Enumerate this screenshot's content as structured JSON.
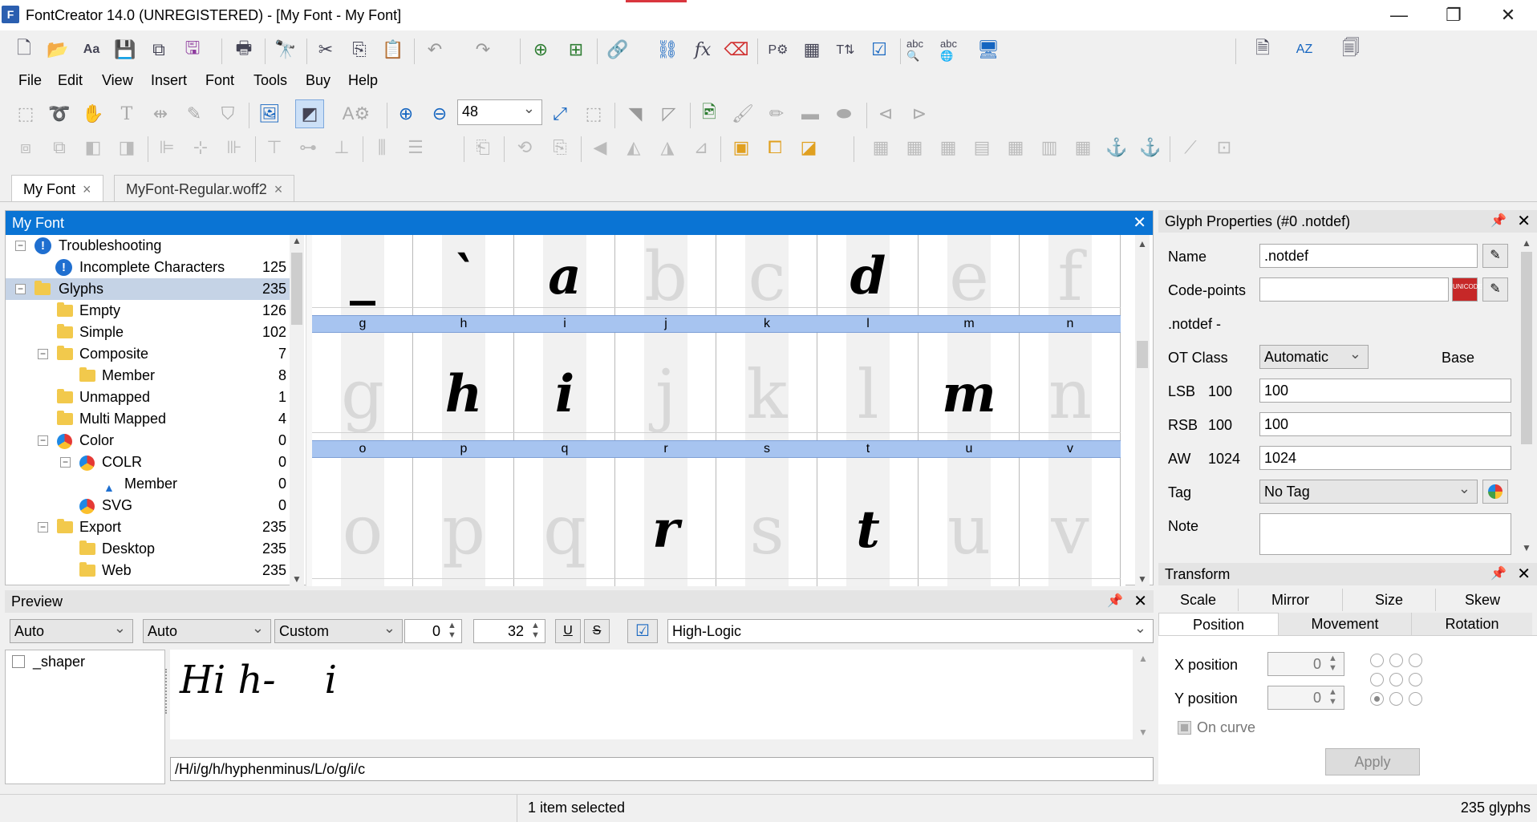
{
  "window": {
    "title": "FontCreator 14.0 (UNREGISTERED) - [My Font - My Font]",
    "app_icon": "F",
    "minimize": "—",
    "restore": "❐",
    "close": "✕"
  },
  "menu": [
    "File",
    "Edit",
    "View",
    "Insert",
    "Font",
    "Tools",
    "Buy",
    "Help"
  ],
  "toolbar": {
    "zoom_value": "48"
  },
  "tabs": [
    {
      "label": "My Font",
      "close": "×"
    },
    {
      "label": "MyFont-Regular.woff2",
      "close": "×"
    }
  ],
  "font_panel": {
    "title": "My Font",
    "close": "✕",
    "tree": [
      {
        "label": "Troubleshooting",
        "count": ""
      },
      {
        "label": "Incomplete Characters",
        "count": "125"
      },
      {
        "label": "Glyphs",
        "count": "235"
      },
      {
        "label": "Empty",
        "count": "126"
      },
      {
        "label": "Simple",
        "count": "102"
      },
      {
        "label": "Composite",
        "count": "7"
      },
      {
        "label": "Member",
        "count": "8"
      },
      {
        "label": "Unmapped",
        "count": "1"
      },
      {
        "label": "Multi Mapped",
        "count": "4"
      },
      {
        "label": "Color",
        "count": "0"
      },
      {
        "label": "COLR",
        "count": "0"
      },
      {
        "label": "Member",
        "count": "0"
      },
      {
        "label": "SVG",
        "count": "0"
      },
      {
        "label": "Export",
        "count": "235"
      },
      {
        "label": "Desktop",
        "count": "235"
      },
      {
        "label": "Web",
        "count": "235"
      }
    ],
    "grid_row1_glyphs": [
      "_",
      "`",
      "a",
      "b",
      "c",
      "d",
      "e",
      "f"
    ],
    "grid_row2_labels": [
      "g",
      "h",
      "i",
      "j",
      "k",
      "l",
      "m",
      "n"
    ],
    "grid_row2_glyphs": [
      "g",
      "h",
      "i",
      "j",
      "k",
      "l",
      "m",
      "n"
    ],
    "grid_row3_labels": [
      "o",
      "p",
      "q",
      "r",
      "s",
      "t",
      "u",
      "v"
    ],
    "grid_row3_glyphs": [
      "o",
      "p",
      "q",
      "r",
      "s",
      "t",
      "u",
      "v"
    ]
  },
  "glyph_properties": {
    "title": "Glyph Properties (#0 .notdef)",
    "name_label": "Name",
    "name_value": ".notdef",
    "codepoints_label": "Code-points",
    "codepoints_value": "",
    "glyph_desc": ".notdef -",
    "otclass_label": "OT Class",
    "otclass_value": "Automatic",
    "otclass_base": "Base",
    "lsb_label": "LSB",
    "lsb_current": "100",
    "lsb_value": "100",
    "rsb_label": "RSB",
    "rsb_current": "100",
    "rsb_value": "100",
    "aw_label": "AW",
    "aw_current": "1024",
    "aw_value": "1024",
    "tag_label": "Tag",
    "tag_value": "No Tag",
    "note_label": "Note",
    "unicode_badge": "UNICODE"
  },
  "transform": {
    "title": "Transform",
    "tabs_top": [
      "Scale",
      "Mirror",
      "Size",
      "Skew"
    ],
    "tabs_bottom": [
      "Position",
      "Movement",
      "Rotation"
    ],
    "x_label": "X position",
    "x_value": "0",
    "y_label": "Y position",
    "y_value": "0",
    "on_curve": "On curve",
    "apply": "Apply"
  },
  "preview": {
    "title": "Preview",
    "combo1": "Auto",
    "combo2": "Auto",
    "combo3": "Custom",
    "spin1": "0",
    "spin2": "32",
    "underline": "U",
    "strike": "S",
    "font_name": "High-Logic",
    "shaper_label": "_shaper",
    "preview_text": "Hi h-    i",
    "sequence": "/H/i/g/h/hyphenminus/L/o/g/i/c"
  },
  "status": {
    "selected": "1 item selected",
    "glyphs": "235 glyphs"
  },
  "colors": {
    "accent": "#0a74d4",
    "grid_header": "#a7c4f0"
  }
}
